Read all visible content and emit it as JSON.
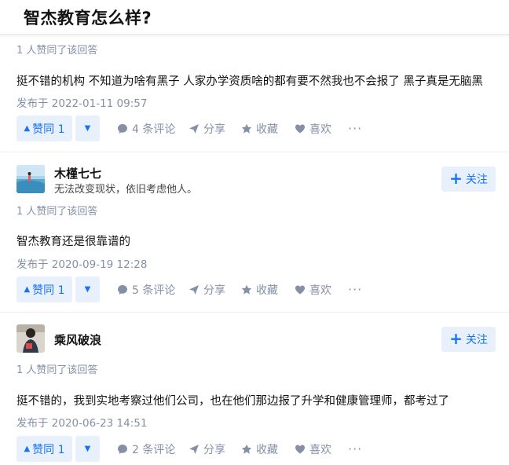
{
  "question": {
    "title": "智杰教育怎么样?"
  },
  "labels": {
    "vote_up": "赞同",
    "share": "分享",
    "collect": "收藏",
    "like": "喜欢",
    "follow": "关注",
    "comments_suffix": "条评论",
    "more": "···"
  },
  "answers": [
    {
      "vote_line": "1 人赞同了该回答",
      "content": "挺不错的机构 不知道为啥有黑子 人家办学资质啥的都有要不然我也不会报了 黑子真是无脑黑",
      "publish_time": "发布于 2022-01-11 09:57",
      "vote_label": "赞同 1",
      "comments_label": "4 条评论"
    },
    {
      "author_name": "木槿七七",
      "author_bio": "无法改变现状，依旧考虑他人。",
      "vote_line": "1 人赞同了该回答",
      "content": "智杰教育还是很靠谱的",
      "publish_time": "发布于 2020-09-19 12:28",
      "vote_label": "赞同 1",
      "comments_label": "5 条评论"
    },
    {
      "author_name": "乘风破浪",
      "author_bio": "",
      "vote_line": "1 人赞同了该回答",
      "content": "挺不错的，我到实地考察过他们公司，也在他们那边报了升学和健康管理师，都考过了",
      "publish_time": "发布于 2020-06-23 14:51",
      "vote_label": "赞同 1",
      "comments_label": "2 条评论"
    }
  ]
}
